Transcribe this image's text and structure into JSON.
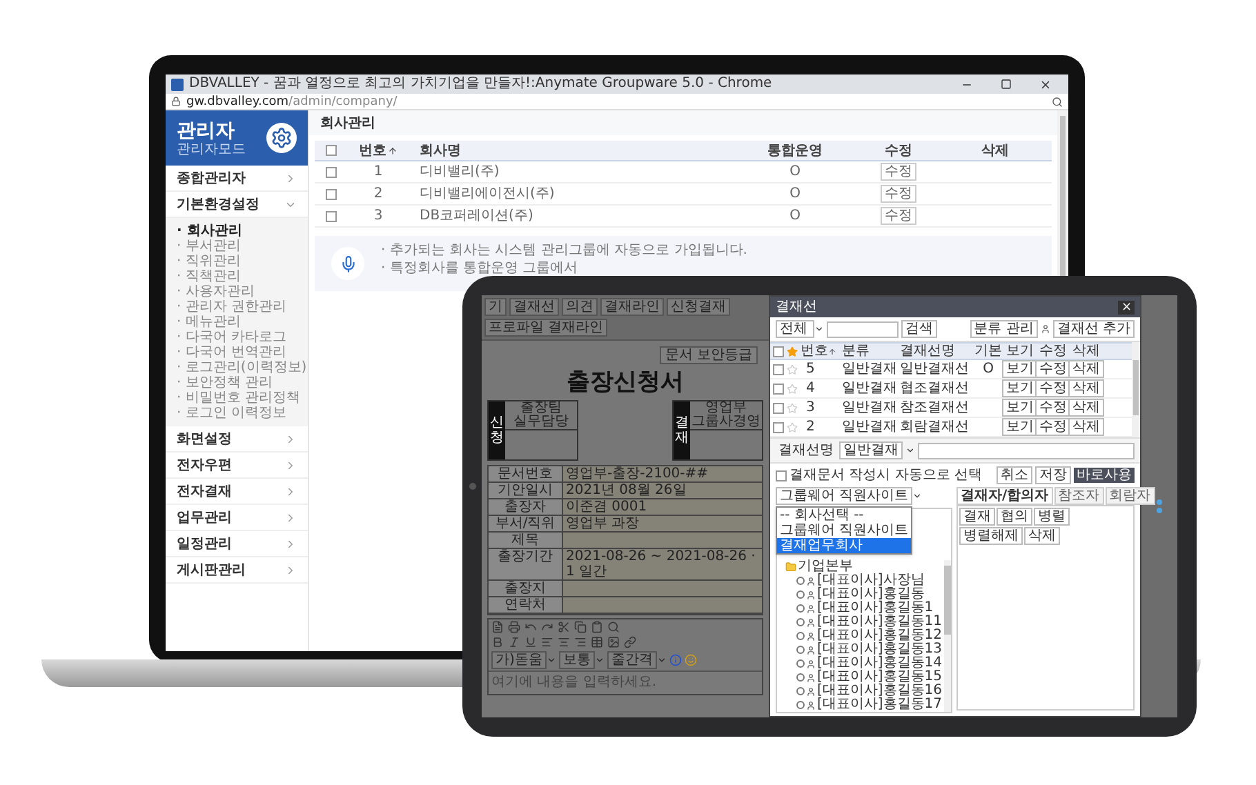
{
  "browser": {
    "title": "DBVALLEY - 꿈과 열정으로 최고의 가치기업을 만들자!:Anymate Groupware 5.0 - Chrome",
    "url_host": "gw.dbvalley.com",
    "url_path": "/admin/company/"
  },
  "sidebar": {
    "title": "관리자",
    "subtitle": "관리자모드",
    "items": [
      {
        "label": "종합관리자",
        "expanded": false
      },
      {
        "label": "기본환경설정",
        "expanded": true,
        "children": [
          {
            "label": "· 회사관리",
            "selected": true
          },
          {
            "label": "· 부서관리",
            "selected": false
          },
          {
            "label": "· 직위관리",
            "selected": false
          },
          {
            "label": "· 직책관리",
            "selected": false
          },
          {
            "label": "· 사용자관리",
            "selected": false
          },
          {
            "label": "· 관리자 권한관리",
            "selected": false
          },
          {
            "label": "· 메뉴관리",
            "selected": false
          },
          {
            "label": "· 다국어 카타로그",
            "selected": false
          },
          {
            "label": "· 다국어 번역관리",
            "selected": false
          },
          {
            "label": "· 로그관리(이력정보)",
            "selected": false
          },
          {
            "label": "· 보안정책 관리",
            "selected": false
          },
          {
            "label": "· 비밀번호 관리정책",
            "selected": false
          },
          {
            "label": "· 로그인 이력정보",
            "selected": false
          }
        ]
      },
      {
        "label": "화면설정",
        "expanded": false
      },
      {
        "label": "전자우편",
        "expanded": false
      },
      {
        "label": "전자결재",
        "expanded": false
      },
      {
        "label": "업무관리",
        "expanded": false
      },
      {
        "label": "일정관리",
        "expanded": false
      },
      {
        "label": "게시판관리",
        "expanded": false
      }
    ]
  },
  "page": {
    "title": "회사관리",
    "table": {
      "header_checked": false,
      "columns": [
        "번호",
        "회사명",
        "통합운영",
        "수정",
        "삭제"
      ],
      "rows": [
        {
          "checked": false,
          "no": "1",
          "name": "디비밸리(주)",
          "integrated": "O",
          "edit": "수정"
        },
        {
          "checked": false,
          "no": "2",
          "name": "디비밸리에이전시(주)",
          "integrated": "O",
          "edit": "수정"
        },
        {
          "checked": false,
          "no": "3",
          "name": "DB코퍼레이션(주)",
          "integrated": "O",
          "edit": "수정"
        }
      ]
    },
    "notes": [
      "· 추가되는 회사는 시스템 관리그룹에 자동으로 가입됩니다.",
      "· 특정회사를 통합운영 그룹에서"
    ]
  },
  "tablet": {
    "toolbar": [
      "기",
      "결재선",
      "의견",
      "결재라인",
      "신청결재",
      "프로파일 결재라인"
    ],
    "form": {
      "security_button": "문서 보안등급",
      "title": "출장신청서",
      "approvals": [
        {
          "side": "신청",
          "head": [
            "출장팀",
            "실무담당"
          ]
        },
        {
          "side": "결재",
          "head": [
            "영업부",
            "그룹사경영"
          ]
        }
      ],
      "rows": [
        {
          "label": "문서번호",
          "value": "영업부-출장-2100-##"
        },
        {
          "label": "기안일시",
          "value": "2021년 08월 26일"
        },
        {
          "label": "출장자",
          "value": "이준겸 0001"
        },
        {
          "label": "부서/직위",
          "value": "영업부 과장"
        },
        {
          "label": "제목",
          "value": ""
        },
        {
          "label": "출장기간",
          "value": "2021-08-26 ~ 2021-08-26 · 1 일간"
        },
        {
          "label": "출장지",
          "value": ""
        },
        {
          "label": "연락처",
          "value": ""
        }
      ],
      "editor_selects": [
        "가)돋움",
        "보통",
        "줄간격"
      ],
      "placeholder": "여기에 내용을 입력하세요."
    },
    "dialog": {
      "title": "결재선",
      "close": "×",
      "filter": "전체",
      "search_button": "검색",
      "buttons": [
        "분류 관리",
        "결재선 추가"
      ],
      "header_checked": false,
      "columns": [
        "번호",
        "분류",
        "결재선명",
        "기본",
        "보기",
        "수정",
        "삭제"
      ],
      "rows": [
        {
          "checked": false,
          "starred": false,
          "no": "5",
          "category": "일반결재",
          "name": "일반결재선",
          "default": "O",
          "view": "보기",
          "edit": "수정",
          "delete": "삭제"
        },
        {
          "checked": false,
          "starred": false,
          "no": "4",
          "category": "일반결재",
          "name": "협조결재선",
          "default": "",
          "view": "보기",
          "edit": "수정",
          "delete": "삭제"
        },
        {
          "checked": false,
          "starred": false,
          "no": "3",
          "category": "일반결재",
          "name": "참조결재선",
          "default": "",
          "view": "보기",
          "edit": "수정",
          "delete": "삭제"
        },
        {
          "checked": false,
          "starred": false,
          "no": "2",
          "category": "일반결재",
          "name": "회람결재선",
          "default": "",
          "view": "보기",
          "edit": "수정",
          "delete": "삭제"
        }
      ],
      "name_label": "결재선명",
      "name_select": "일반결재",
      "auto_select": {
        "label": "결재문서 작성시 자동으로 선택",
        "checked": false
      },
      "actions": [
        "취소",
        "저장",
        "바로사용"
      ],
      "group_select": "그룹웨어 직원사이트",
      "group_options": [
        {
          "label": "-- 회사선택 --",
          "selected": false
        },
        {
          "label": "그룹웨어 직원사이트",
          "selected": false
        },
        {
          "label": "결재업무회사",
          "selected": true
        }
      ],
      "tree": [
        {
          "label": "기업본부",
          "expanded": true,
          "children": [
            {
              "label": "[대표이사]사장님",
              "checked": false
            },
            {
              "label": "[대표이사]홍길동",
              "checked": false
            },
            {
              "label": "[대표이사]홍길동1",
              "checked": false
            },
            {
              "label": "[대표이사]홍길동11",
              "checked": false
            },
            {
              "label": "[대표이사]홍길동12",
              "checked": false
            },
            {
              "label": "[대표이사]홍길동13",
              "checked": false
            },
            {
              "label": "[대표이사]홍길동14",
              "checked": false
            },
            {
              "label": "[대표이사]홍길동15",
              "checked": false
            },
            {
              "label": "[대표이사]홍길동16",
              "checked": false
            },
            {
              "label": "[대표이사]홍길동17",
              "checked": false
            }
          ]
        }
      ],
      "tabs": [
        {
          "label": "결재자/합의자",
          "selected": true
        },
        {
          "label": "참조자",
          "selected": false
        },
        {
          "label": "회람자",
          "selected": false
        }
      ],
      "panel_buttons": [
        "결재",
        "협의",
        "병렬",
        "병렬해제",
        "삭제"
      ]
    }
  }
}
